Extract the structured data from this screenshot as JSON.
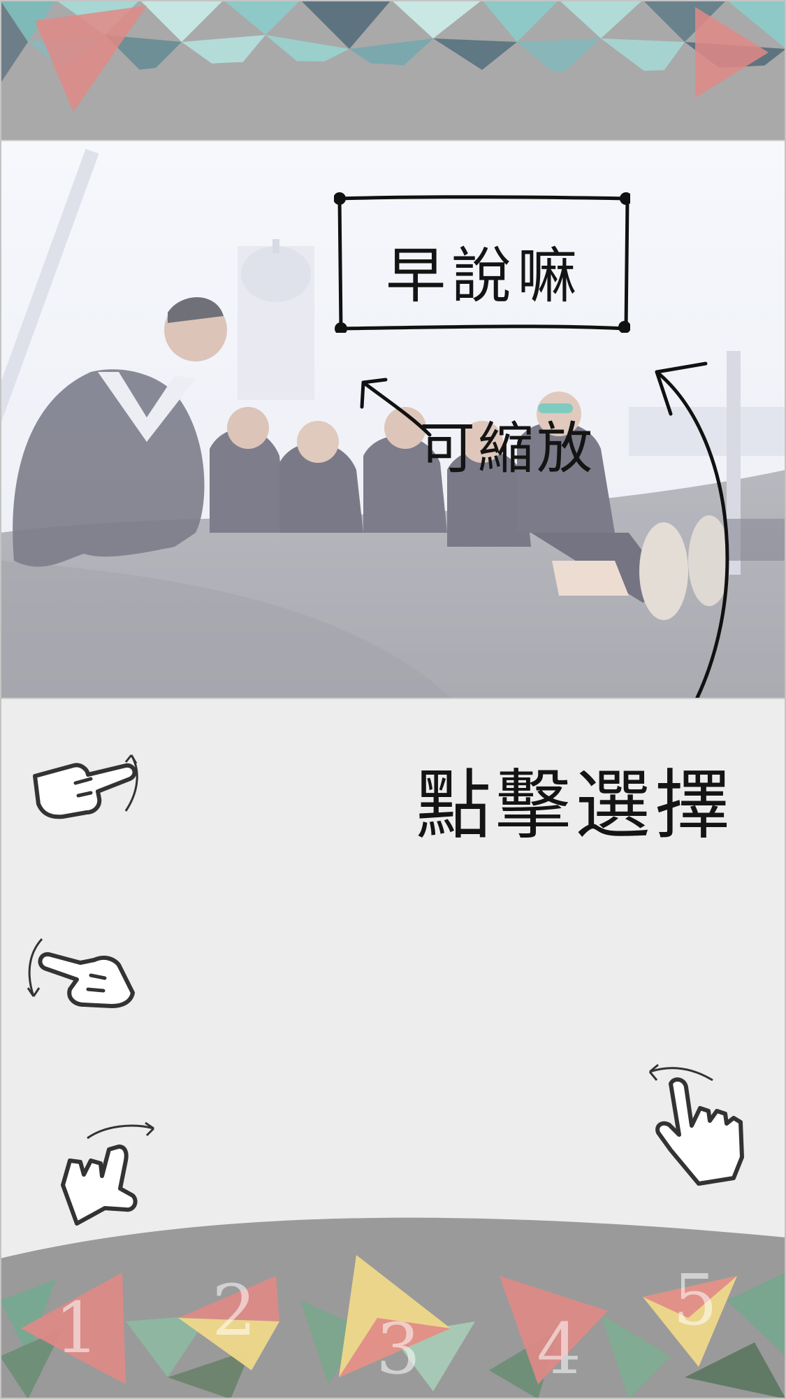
{
  "canvas": {
    "sticker_text": "早說嘛",
    "scale_hint": "可縮放",
    "select_hint": "點擊選擇"
  },
  "gesture_icons": [
    "swipe-up-right-hand-icon",
    "swipe-down-left-hand-icon",
    "rotate-right-hand-icon",
    "rotate-left-hand-icon"
  ],
  "tabs": [
    {
      "number": "1"
    },
    {
      "number": "2"
    },
    {
      "number": "3"
    },
    {
      "number": "4"
    },
    {
      "number": "5"
    }
  ],
  "colors": {
    "teal": "#8ec9c7",
    "coral": "#e08a86",
    "yellow": "#efd88a",
    "banner_gray": "#a9a9a9",
    "panel": "#ededed"
  }
}
